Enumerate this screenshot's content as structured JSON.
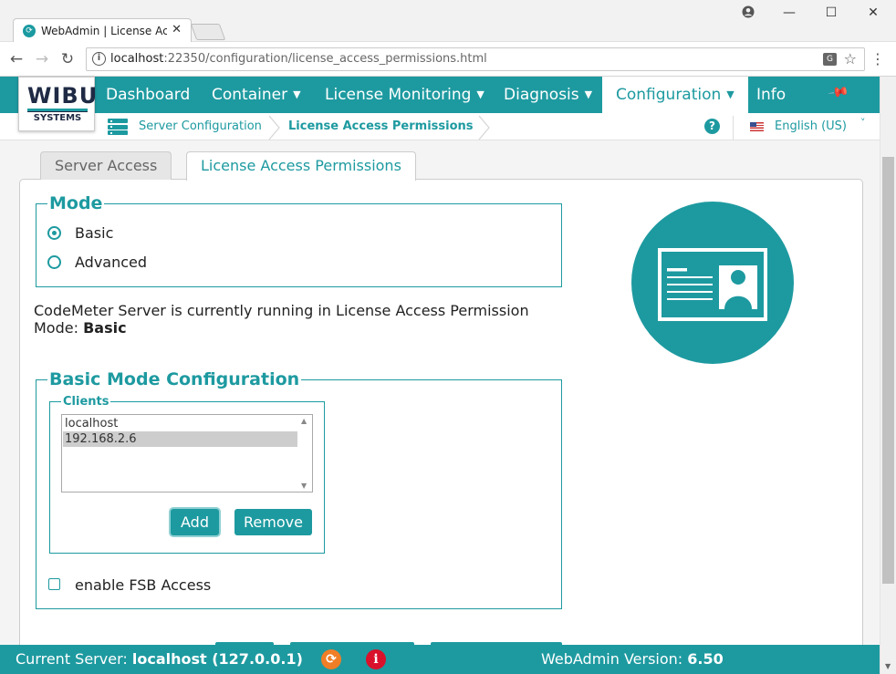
{
  "browser": {
    "tab_title": "WebAdmin | License Access Permissions",
    "url_host": "localhost",
    "url_path": ":22350/configuration/license_access_permissions.html",
    "translate_glyph": "G",
    "favicon_glyph": "⟳"
  },
  "icons": {
    "back": "back-arrow-icon",
    "forward": "forward-arrow-icon",
    "reload": "reload-icon",
    "info": "info-icon",
    "translate": "translate-icon",
    "star": "star-icon",
    "menu": "kebab-menu-icon",
    "account": "account-icon",
    "pin": "pin-icon",
    "help": "help-icon",
    "flag": "us-flag-icon",
    "server": "server-icon",
    "refresh": "refresh-icon",
    "alert": "alert-icon",
    "id_card": "id-card-icon"
  },
  "logo": {
    "top": "WIBU",
    "bottom": "SYSTEMS"
  },
  "nav": {
    "items": [
      {
        "label": "Dashboard"
      },
      {
        "label": "Container"
      },
      {
        "label": "License Monitoring"
      },
      {
        "label": "Diagnosis"
      },
      {
        "label": "Configuration"
      },
      {
        "label": "Info"
      }
    ]
  },
  "breadcrumb": {
    "items": [
      {
        "label": "Server Configuration"
      },
      {
        "label": "License Access Permissions"
      }
    ]
  },
  "language": {
    "label": "English (US)"
  },
  "tabs": [
    {
      "label": "Server Access"
    },
    {
      "label": "License Access Permissions"
    }
  ],
  "mode": {
    "legend": "Mode",
    "options": [
      {
        "label": "Basic",
        "checked": true
      },
      {
        "label": "Advanced",
        "checked": false
      }
    ],
    "status_text": "CodeMeter Server is currently running in License Access Permission Mode:",
    "status_value": "Basic"
  },
  "basic": {
    "legend": "Basic Mode Configuration",
    "clients_legend": "Clients",
    "clients": [
      {
        "name": "localhost",
        "selected": false
      },
      {
        "name": "192.168.2.6",
        "selected": true
      }
    ],
    "add_label": "Add",
    "remove_label": "Remove",
    "fsb_label": "enable FSB Access",
    "fsb_checked": false
  },
  "footer": {
    "server_label": "Current Server:",
    "server_value": "localhost (127.0.0.1)",
    "version_label": "WebAdmin Version:",
    "version_value": "6.50"
  },
  "colors": {
    "accent": "#1d9aa0",
    "refresh": "#f07e26",
    "alert": "#d9112b"
  }
}
